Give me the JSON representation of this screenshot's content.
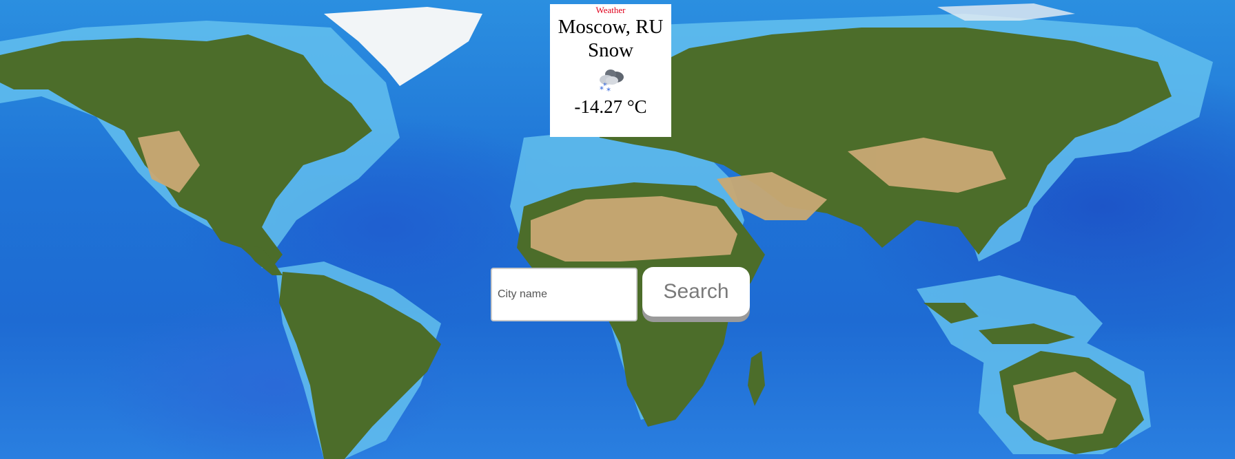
{
  "weather": {
    "title": "Weather",
    "location": "Moscow, RU",
    "condition": "Snow",
    "icon": "snow-cloud-icon",
    "temperature": "-14.27 °C"
  },
  "search": {
    "placeholder": "City name",
    "value": "",
    "button_label": "Search"
  },
  "colors": {
    "title_accent": "#e0001b",
    "ocean": "#1f73d6",
    "button_text": "#7a7a7a",
    "button_shadow": "#9a9a9a"
  }
}
